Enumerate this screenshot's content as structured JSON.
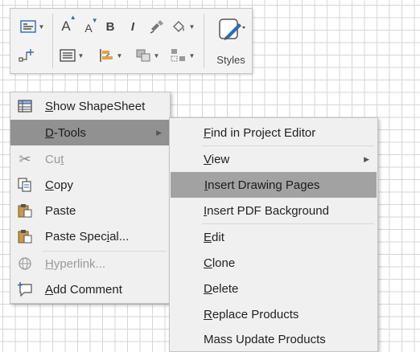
{
  "toolbar": {
    "grow_font_label": "A",
    "shrink_font_label": "A",
    "bold_label": "B",
    "italic_label": "I",
    "styles_label": "Styles",
    "icons": [
      "text-block-icon",
      "connector-icon",
      "grow-font-icon",
      "shrink-font-icon",
      "bold-icon",
      "italic-icon",
      "format-painter-icon",
      "fill-icon",
      "align-icon",
      "position-icon",
      "arrange-icon",
      "group-icon",
      "styles-icon"
    ]
  },
  "context_menu": {
    "items": [
      {
        "label_pre": "",
        "label_u": "S",
        "label_post": "how ShapeSheet",
        "icon": "shapesheet-icon",
        "disabled": false
      },
      {
        "label_pre": "",
        "label_u": "D",
        "label_post": "-Tools",
        "icon": "",
        "disabled": false,
        "submenu": true,
        "highlighted": true
      },
      {
        "label_pre": "Cu",
        "label_u": "t",
        "label_post": "",
        "icon": "scissors-icon",
        "disabled": true
      },
      {
        "label_pre": "",
        "label_u": "C",
        "label_post": "opy",
        "icon": "copy-icon",
        "disabled": false
      },
      {
        "label_pre": "",
        "label_u": "",
        "label_post": "Paste",
        "icon": "paste-icon",
        "disabled": false
      },
      {
        "label_pre": "Paste Spec",
        "label_u": "i",
        "label_post": "al...",
        "icon": "paste-special-icon",
        "disabled": false
      },
      {
        "label_pre": "",
        "label_u": "H",
        "label_post": "yperlink...",
        "icon": "hyperlink-icon",
        "disabled": true
      },
      {
        "label_pre": "",
        "label_u": "A",
        "label_post": "dd Comment",
        "icon": "comment-icon",
        "disabled": false
      }
    ]
  },
  "submenu": {
    "items": [
      {
        "label_pre": "",
        "label_u": "F",
        "label_post": "ind in Project Editor"
      },
      {
        "label_pre": "",
        "label_u": "V",
        "label_post": "iew",
        "submenu": true
      },
      {
        "label_pre": "",
        "label_u": "I",
        "label_post": "nsert Drawing Pages",
        "highlighted": true
      },
      {
        "label_pre": "",
        "label_u": "I",
        "label_post": "nsert PDF Background"
      },
      {
        "label_pre": "",
        "label_u": "E",
        "label_post": "dit"
      },
      {
        "label_pre": "",
        "label_u": "C",
        "label_post": "lone"
      },
      {
        "label_pre": "",
        "label_u": "D",
        "label_post": "elete"
      },
      {
        "label_pre": "",
        "label_u": "R",
        "label_post": "eplace Products"
      },
      {
        "label_pre": "",
        "label_u": "",
        "label_post": "Mass Update Products"
      }
    ]
  },
  "colors": {
    "highlight": "#919191",
    "submenu_highlight": "#a2a2a2",
    "menu_bg": "#f0f0f0",
    "accent_blue": "#2b6cb8"
  }
}
